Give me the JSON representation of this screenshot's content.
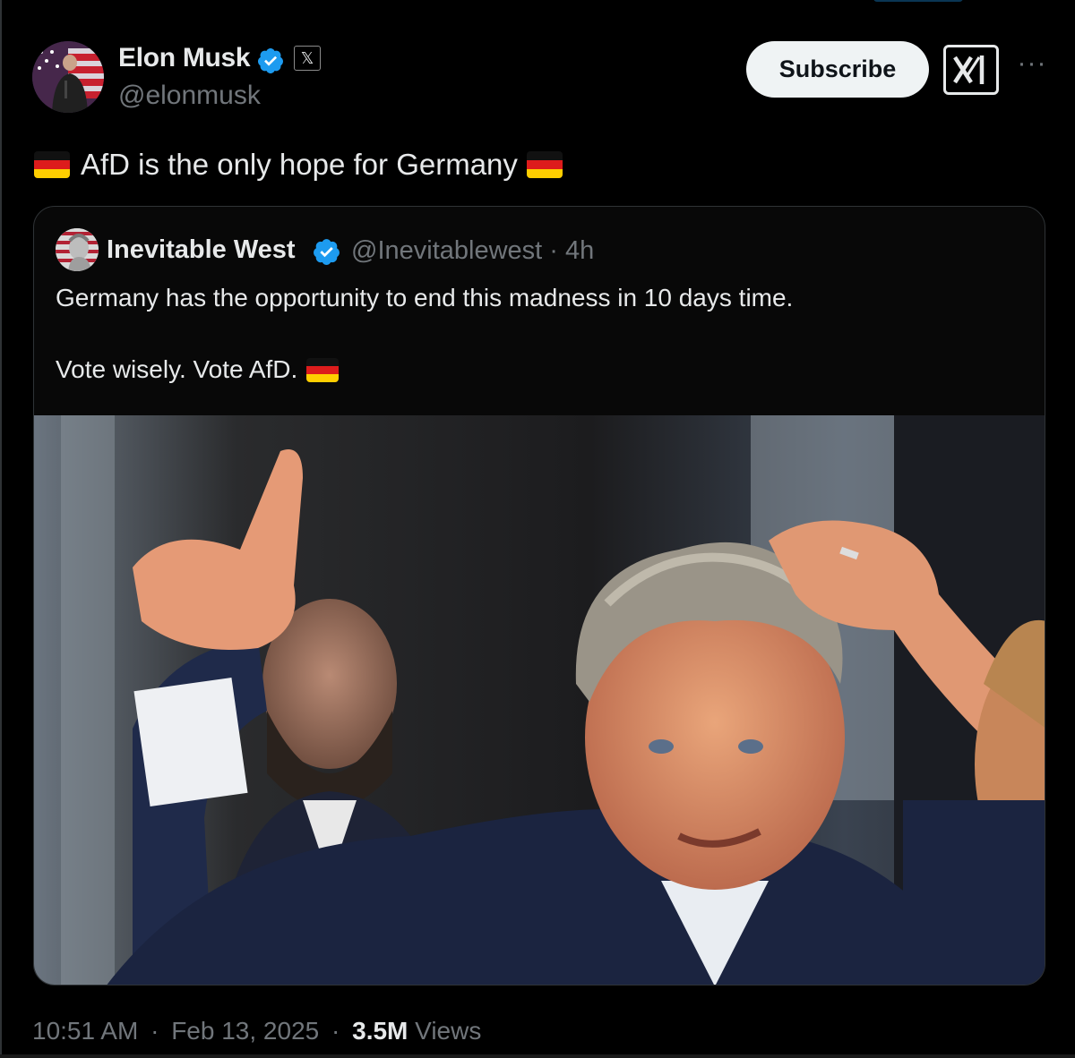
{
  "post": {
    "author_name": "Elon Musk",
    "author_handle": "@elonmusk",
    "subscribe_label": "Subscribe",
    "affiliation_badge": "𝕏",
    "more_label": "···",
    "text": "AfD is the only hope for Germany",
    "flag_colors": [
      "#000000",
      "#dd0000",
      "#ffce00"
    ]
  },
  "quote": {
    "author_name": "Inevitable West",
    "author_handle": "@Inevitablewest",
    "separator": "·",
    "time": "4h",
    "line1": "Germany has the opportunity to end this madness in 10 days time.",
    "line2": "Vote wisely. Vote AfD."
  },
  "footer": {
    "time": "10:51 AM",
    "date": "Feb 13, 2025",
    "separator": "·",
    "views_count": "3.5M",
    "views_label": "Views"
  },
  "colors": {
    "background": "#000000",
    "text_primary": "#e7e9ea",
    "text_secondary": "#71767b",
    "verified_blue": "#1d9bf0",
    "border": "#2f3336"
  }
}
